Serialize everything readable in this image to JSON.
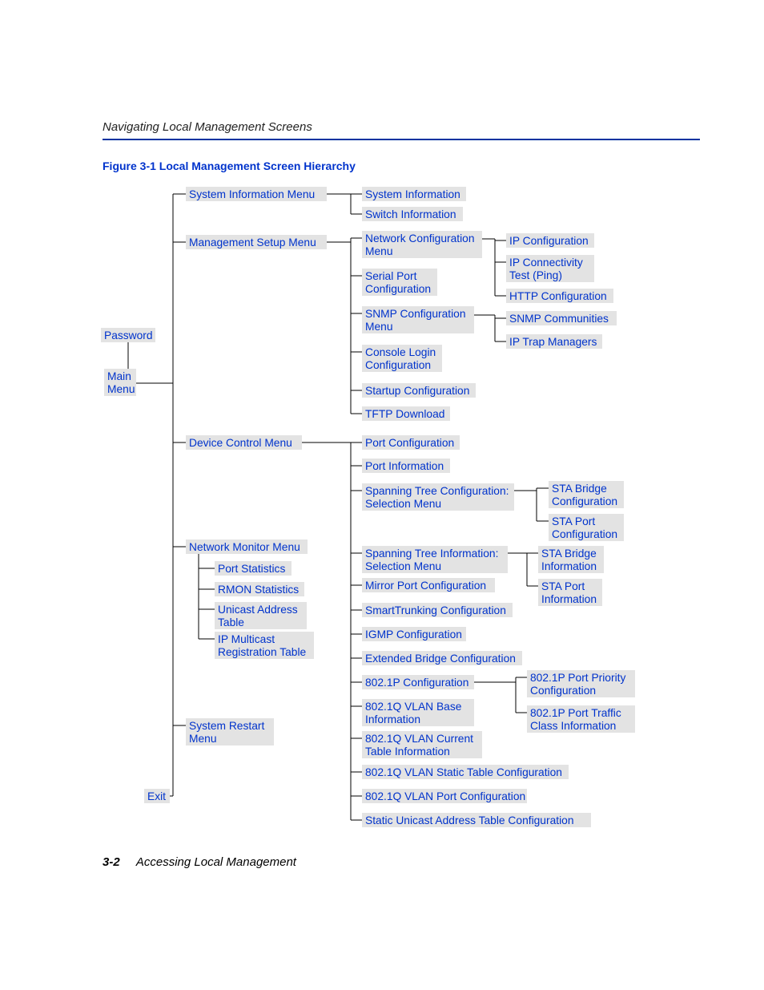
{
  "header": "Navigating Local Management Screens",
  "caption": "Figure 3-1   Local Management Screen Hierarchy",
  "footer": {
    "pagenum": "3-2",
    "chapter": "Accessing Local Management"
  },
  "c0": {
    "password": "Password",
    "main1": "Main",
    "main2": "Menu",
    "exit": "Exit"
  },
  "c1": {
    "sysinfo": "System Information Menu",
    "mgmt": "Management Setup Menu",
    "device": "Device Control Menu",
    "netmon": "Network Monitor Menu",
    "portstats": "Port Statistics",
    "rmon": "RMON Statistics",
    "unicast1": "Unicast Address",
    "unicast2": "Table",
    "ipmc1": "IP Multicast",
    "ipmc2": "Registration Table",
    "restart1": "System Restart",
    "restart2": "Menu"
  },
  "c2": {
    "sysinfo": "System Information",
    "switchinfo": "Switch Information",
    "netcfg1": "Network Configuration",
    "netcfg2": "Menu",
    "serial1": "Serial Port",
    "serial2": "Configuration",
    "snmp1": "SNMP Configuration",
    "snmp2": "Menu",
    "conlogin1": "Console Login",
    "conlogin2": "Configuration",
    "startup": "Startup Configuration",
    "tftp": "TFTP Download",
    "portcfg": "Port Configuration",
    "portinfo": "Port Information",
    "stc1": "Spanning Tree Configuration:",
    "stc2": "Selection Menu",
    "sti1": "Spanning Tree Information:",
    "sti2": "Selection Menu",
    "mirror": "Mirror Port Configuration",
    "smarttrunk": "SmartTrunking Configuration",
    "igmp": "IGMP Configuration",
    "extbridge": "Extended Bridge Configuration",
    "p8021": "802.1P Configuration",
    "vlanbase1": "802.1Q VLAN Base",
    "vlanbase2": "Information",
    "vlancur1": "802.1Q VLAN Current",
    "vlancur2": "Table Information",
    "vlanstatic": "802.1Q VLAN Static Table Configuration",
    "vlanport": "802.1Q VLAN Port Configuration",
    "staticuni": "Static Unicast Address Table Configuration"
  },
  "c3": {
    "ipcfg": "IP Configuration",
    "ipconn1": "IP Connectivity",
    "ipconn2": "Test (Ping)",
    "http": "HTTP Configuration",
    "snmpcomm": "SNMP Communities",
    "iptrap": "IP Trap Managers",
    "stabridgecfg1": "STA Bridge",
    "stabridgecfg2": "Configuration",
    "staportcfg1": "STA Port",
    "staportcfg2": "Configuration",
    "stabridgeinfo1": "STA Bridge",
    "stabridgeinfo2": "Information",
    "staportinfo1": "STA Port",
    "staportinfo2": "Information",
    "p8021prio1": "802.1P Port Priority",
    "p8021prio2": "Configuration",
    "p8021traf1": "802.1P Port Traffic",
    "p8021traf2": "Class Information"
  }
}
